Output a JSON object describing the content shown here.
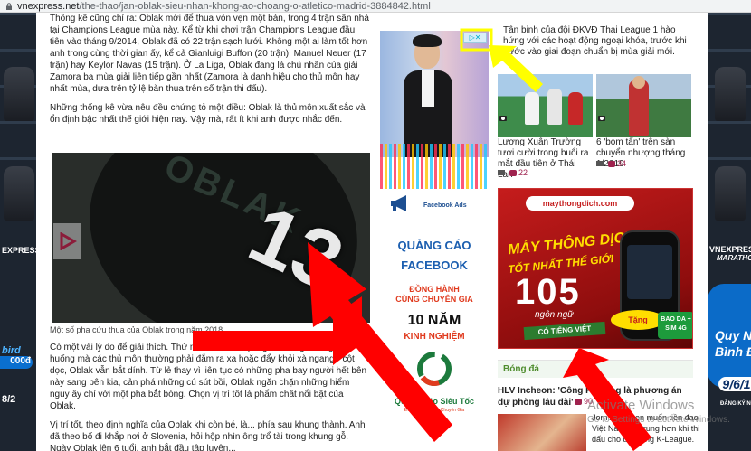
{
  "browser": {
    "url_host": "vnexpress.net",
    "url_path": "/the-thao/jan-oblak-sieu-nhan-khong-ao-choang-o-atletico-madrid-3884842.html"
  },
  "article": {
    "p1": "Thống kê cũng chỉ ra: Oblak mới để thua vỏn vẹn một bàn, trong 4 trận sân nhà tại Champions League mùa này. Kể từ khi chơi trận Champions League đầu tiên vào tháng 9/2014, Oblak đã có 22 trận sạch lưới. Không một ai làm tốt hơn anh trong cùng thời gian ấy, kể cả Gianluigi Buffon (20 trận), Manuel Neuer (17 trận) hay Keylor Navas (15 trận). Ở La Liga, Oblak đang là chủ nhân của giải Zamora ba mùa giải liên tiếp gần nhất (Zamora là danh hiệu cho thủ môn hay nhất mùa, dựa trên tỷ lệ bàn thua trên số trận thi đấu).",
    "p2": "Những thống kê vừa nêu đều chứng tỏ một điều: Oblak là thủ môn xuất sắc và ổn định bậc nhất thế giới hiện nay. Vậy mà, rất ít khi anh được nhắc đến.",
    "video_caption": "Một số pha cứu thua của Oblak trong năm 2018.",
    "jersey_text": "OBLAK",
    "jersey_number": "13",
    "p3": "Có một vài lý do để giải thích. Thứ nhất là anh... quá giỏi. Trong những tình huống mà các thủ môn thường phải đắm ra xa hoặc đẩy khỏi xà ngang - cột dọc, Oblak vẫn bắt dính. Từ lẻ thay vì liên tục có những pha bay người hết bên này sang bên kia, cản phá những cú sút bồi, Oblak ngăn chặn những hiểm nguy ấy chỉ với một pha bắt bóng. Chọn vị trí tốt là phẩm chất nổi bật của Oblak.",
    "p4": "Vị trí tốt, theo định nghĩa của Oblak khi còn bé, là... phía sau khung thành. Anh đã theo bố đi khắp nơi ở Slovenia, hỏi hộp nhìn ông trổ tài trong khung gỗ. Ngày Oblak lên 6 tuổi, anh bắt đầu tập luyện..."
  },
  "mid_ad": {
    "adchoice": "▷✕",
    "fb_ads": "Facebook Ads",
    "line1": "QUẢNG CÁO",
    "line2": "FACEBOOK",
    "line3": "ĐỒNG HÀNH",
    "line4": "CÙNG CHUYÊN GIA",
    "line5": "10 NĂM",
    "line6": "KINH NGHIỆM",
    "brand": "Quảng Cáo Siêu Tốc",
    "brand_sub": "Đồng Hành Cùng Chuyên Gia"
  },
  "right": {
    "top_story": "Tân binh của đội ĐKVĐ Thai League 1 hào hứng với các hoạt động ngoại khóa, trước khi bước vào giai đoạn chuẩn bị mùa giải mới.",
    "story1_title": "Lương Xuân Trường tươi cười trong buổi ra mắt đầu tiên ở Thái Lan",
    "story1_count": "22",
    "story2_title": "6 'bom tấn' trên sàn chuyển nhượng tháng 1/2019",
    "story2_count": "34",
    "ad_brand": "maythongdich.com",
    "ad_h1": "MÁY THÔNG DỊCH",
    "ad_h2": "TỐT NHẤT THẾ GIỚI",
    "ad_number": "105",
    "ad_ngon": "ngôn ngữ",
    "ad_ctv": "CÓ TIẾNG VIỆT",
    "ad_tang": "Tặng",
    "ad_sim": "BAO DA + SIM 4G",
    "section": "Bóng đá",
    "hl_title": "HLV Incheon: 'Công Phượng là phương án dự phòng lâu dài'",
    "hl_count": "90",
    "bottom_text": "Jorn Andersen muốn tiền đạo Việt Nam tập trung hơn khi thi đấu cho đội bóng K-League."
  },
  "overlay": {
    "win1": "Activate Windows",
    "win2": "Go to Settings to activate Windows."
  },
  "colors": {
    "annotation_arrow_red": "#ff0000",
    "annotation_arrow_yellow": "#ffff00",
    "comment_color": "#9f224e",
    "section_green": "#4f8d2e"
  }
}
